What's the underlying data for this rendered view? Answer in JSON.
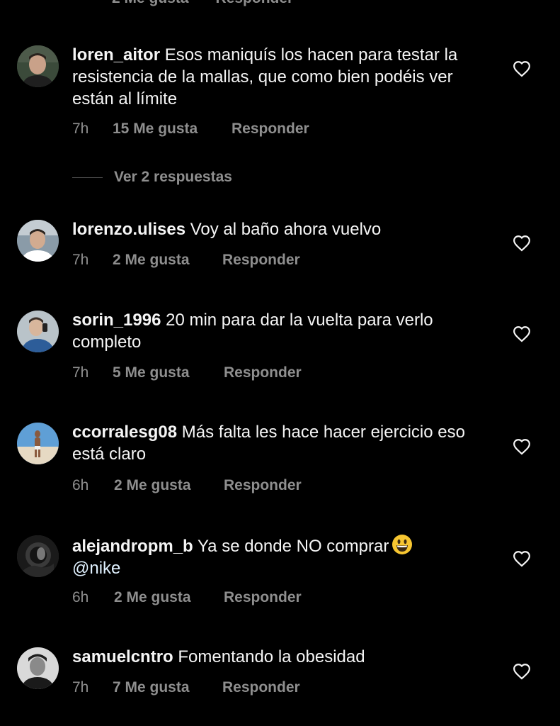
{
  "top_partial": {
    "likes": "2 Me gusta",
    "reply": "Responder"
  },
  "comments": [
    {
      "username": "loren_aitor",
      "text": "Esos maniquís los hacen para testar la resistencia de la mallas, que como bien podéis ver están al límite",
      "time": "7h",
      "likes": "15 Me gusta",
      "reply": "Responder",
      "view_replies": "Ver 2 respuestas"
    },
    {
      "username": "lorenzo.ulises",
      "text": "Voy al baño ahora vuelvo",
      "time": "7h",
      "likes": "2 Me gusta",
      "reply": "Responder"
    },
    {
      "username": "sorin_1996",
      "text": "20 min para dar la vuelta para verlo completo",
      "time": "7h",
      "likes": "5 Me gusta",
      "reply": "Responder"
    },
    {
      "username": "ccorralesg08",
      "text": "Más falta les hace hacer ejercicio eso está claro",
      "time": "6h",
      "likes": "2 Me gusta",
      "reply": "Responder"
    },
    {
      "username": "alejandropm_b",
      "text": "Ya se donde NO comprar",
      "emoji": "grinning-face-emoji",
      "mention": "@nike",
      "time": "6h",
      "likes": "2 Me gusta",
      "reply": "Responder"
    },
    {
      "username": "samuelcntro",
      "text": "Fomentando la obesidad",
      "time": "7h",
      "likes": "7 Me gusta",
      "reply": "Responder"
    }
  ],
  "icons": {
    "like": "heart-outline-icon"
  },
  "colors": {
    "background": "#000000",
    "text": "#f5f5f5",
    "secondary": "#8e8e8e",
    "mention": "#e0f1ff"
  }
}
